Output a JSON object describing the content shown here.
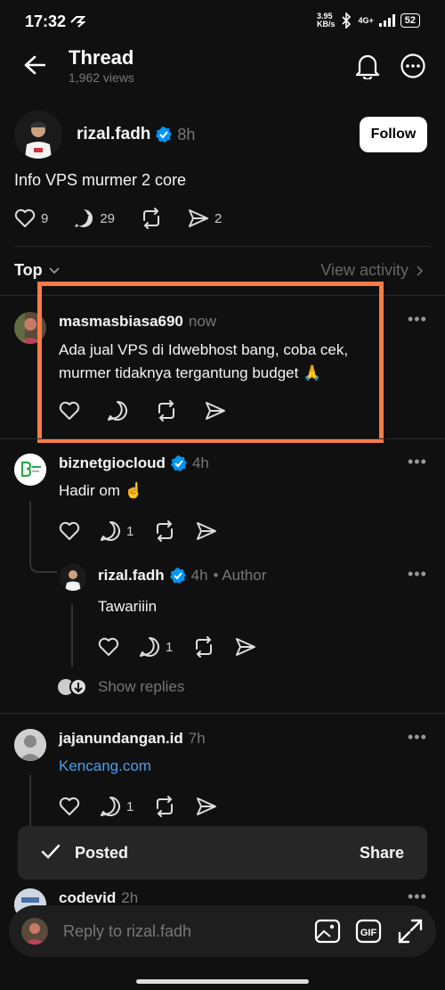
{
  "status_bar": {
    "time": "17:32",
    "network_speed": "3.95",
    "network_unit": "KB/s",
    "network_type": "4G+",
    "battery": "52"
  },
  "header": {
    "title": "Thread",
    "views": "1,962 views"
  },
  "post": {
    "username": "rizal.fadh",
    "time": "8h",
    "follow_label": "Follow",
    "text": "Info VPS murmer 2 core",
    "likes": "9",
    "replies": "29",
    "shares": "2"
  },
  "sort": {
    "label": "Top",
    "view_activity": "View activity"
  },
  "replies": [
    {
      "username": "masmasbiasa690",
      "time": "now",
      "text": "Ada jual VPS di Idwebhost bang, coba cek, murmer tidaknya tergantung budget 🙏"
    },
    {
      "username": "biznetgiocloud",
      "time": "4h",
      "text": "Hadir om ☝️",
      "reply_count": "1"
    },
    {
      "username": "rizal.fadh",
      "time": "4h",
      "author_tag": "• Author",
      "text": "Tawariiin",
      "reply_count": "1"
    },
    {
      "username": "jajanundangan.id",
      "time": "7h",
      "text": "Kencang.com",
      "reply_count": "1"
    },
    {
      "username": "codevid",
      "time": "2h"
    }
  ],
  "show_replies": "Show replies",
  "toast": {
    "label": "Posted",
    "action": "Share"
  },
  "reply_bar": {
    "placeholder": "Reply to rizal.fadh"
  },
  "colors": {
    "background": "#101010",
    "highlight": "#ff7a45",
    "verified": "#0095f6",
    "link": "#4a9fea"
  }
}
